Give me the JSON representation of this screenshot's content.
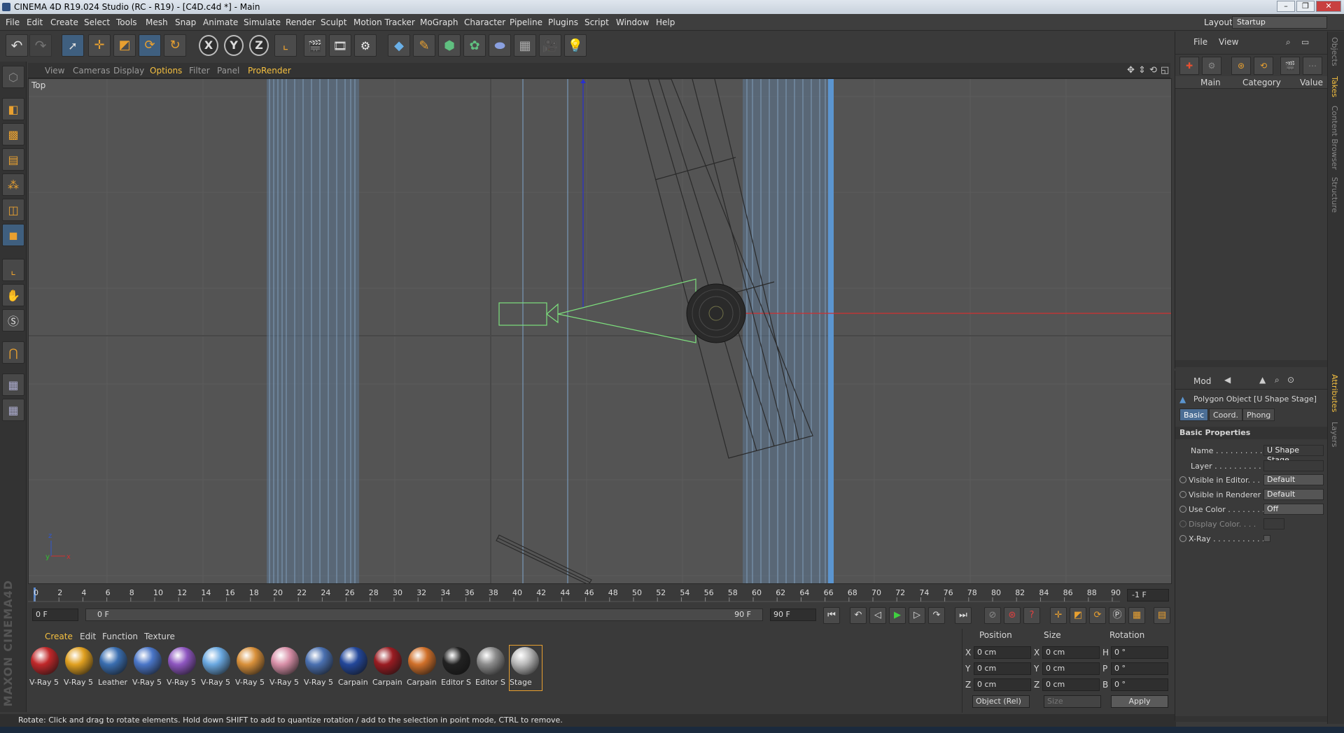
{
  "window": {
    "title": "CINEMA 4D R19.024 Studio (RC - R19) - [C4D.c4d *] - Main"
  },
  "menubar": {
    "items": [
      "File",
      "Edit",
      "Create",
      "Select",
      "Tools",
      "Mesh",
      "Snap",
      "Animate",
      "Simulate",
      "Render",
      "Sculpt",
      "Motion Tracker",
      "MoGraph",
      "Character",
      "Pipeline",
      "Plugins",
      "Script",
      "Window",
      "Help"
    ],
    "layout_label": "Layout:",
    "layout_value": "Startup"
  },
  "toolbar": {
    "icons": [
      "undo-icon",
      "redo-icon",
      "select-icon",
      "move-icon",
      "scale-icon",
      "rotate-icon",
      "rotate-live-icon",
      "x-axis-icon",
      "y-axis-icon",
      "z-axis-icon",
      "coordinate-system-icon",
      "render-view-icon",
      "render-picture-viewer-icon",
      "edit-render-settings-icon",
      "cube-icon",
      "pen-icon",
      "subdivision-icon",
      "cloner-icon",
      "deformer-icon",
      "floor-icon",
      "camera-icon",
      "light-icon"
    ],
    "axis_x": "X",
    "axis_y": "Y",
    "axis_z": "Z"
  },
  "viewport": {
    "menu": [
      "View",
      "Cameras",
      "Display",
      "Options",
      "Filter",
      "Panel",
      "ProRender"
    ],
    "active_menu": "Options",
    "view_name": "Top"
  },
  "timeline": {
    "ticks": [
      "0",
      "2",
      "4",
      "6",
      "8",
      "10",
      "12",
      "14",
      "16",
      "18",
      "20",
      "22",
      "24",
      "26",
      "28",
      "30",
      "32",
      "34",
      "36",
      "38",
      "40",
      "42",
      "44",
      "46",
      "48",
      "50",
      "52",
      "54",
      "56",
      "58",
      "60",
      "62",
      "64",
      "66",
      "68",
      "70",
      "72",
      "74",
      "76",
      "78",
      "80",
      "82",
      "84",
      "86",
      "88",
      "90"
    ],
    "current_frame_display": "-1 F",
    "start_field": "0 F",
    "range_start": "0 F",
    "range_end": "90 F",
    "end_field": "90 F"
  },
  "materials": {
    "menu": [
      "Create",
      "Edit",
      "Function",
      "Texture"
    ],
    "active_menu": "Create",
    "items": [
      {
        "label": "V-Ray 5",
        "color": "#c0282a"
      },
      {
        "label": "V-Ray 5",
        "color": "#e0a020"
      },
      {
        "label": "Leather",
        "color": "#3a6eb0"
      },
      {
        "label": "V-Ray 5",
        "color": "#4a76c8"
      },
      {
        "label": "V-Ray 5",
        "color": "#8e56c0"
      },
      {
        "label": "V-Ray 5",
        "color": "#6aa8e0"
      },
      {
        "label": "V-Ray 5",
        "color": "#d8903a"
      },
      {
        "label": "V-Ray 5",
        "color": "#d890a8"
      },
      {
        "label": "V-Ray 5",
        "color": "#4a70b0"
      },
      {
        "label": "Carpain",
        "color": "#23479a"
      },
      {
        "label": "Carpain",
        "color": "#9a1c22"
      },
      {
        "label": "Carpain",
        "color": "#d0702a"
      },
      {
        "label": "Editor S",
        "color": "#222222"
      },
      {
        "label": "Editor S",
        "color": "#8c8c8c"
      },
      {
        "label": "Stage",
        "color": "#b8b8b8"
      }
    ]
  },
  "coordinates": {
    "headers": [
      "Position",
      "Size",
      "Rotation"
    ],
    "rows": [
      {
        "axis": "X",
        "pos": "0 cm",
        "size_axis": "X",
        "size": "0 cm",
        "rot_axis": "H",
        "rot": "0 °"
      },
      {
        "axis": "Y",
        "pos": "0 cm",
        "size_axis": "Y",
        "size": "0 cm",
        "rot_axis": "P",
        "rot": "0 °"
      },
      {
        "axis": "Z",
        "pos": "0 cm",
        "size_axis": "Z",
        "size": "0 cm",
        "rot_axis": "B",
        "rot": "0 °"
      }
    ],
    "mode": "Object (Rel)",
    "size_mode": "Size",
    "apply": "Apply"
  },
  "objects_panel": {
    "menu": [
      "File",
      "View"
    ],
    "columns": [
      "Main",
      "Category",
      "Value"
    ]
  },
  "attributes": {
    "mode": "Mod",
    "object_title": "Polygon Object [U Shape Stage]",
    "tabs": [
      "Basic",
      "Coord.",
      "Phong"
    ],
    "active_tab": "Basic",
    "section": "Basic Properties",
    "props": [
      {
        "label": "Name . . . . . . . . . . .",
        "value": "U Shape Stage"
      },
      {
        "label": "Layer . . . . . . . . . . .",
        "value": ""
      },
      {
        "label": "Visible in Editor. . .",
        "value": "Default"
      },
      {
        "label": "Visible in Renderer",
        "value": "Default"
      },
      {
        "label": "Use Color . . . . . . . .",
        "value": "Off"
      },
      {
        "label": "Display Color. . . .",
        "value": ""
      },
      {
        "label": "X-Ray . . . . . . . . . . .",
        "value": ""
      }
    ]
  },
  "right_tabs": [
    "Objects",
    "Takes",
    "Content Browser",
    "Structure",
    "Attributes",
    "Layers"
  ],
  "status": {
    "text": "Rotate: Click and drag to rotate elements. Hold down SHIFT to add to quantize rotation / add to the selection in point mode, CTRL to remove."
  },
  "colors": {
    "accent": "#f5c040",
    "selection": "#4b6e95",
    "camera": "#7ddf7d",
    "x_axis": "#d03030",
    "y_axis": "#3030d0"
  }
}
